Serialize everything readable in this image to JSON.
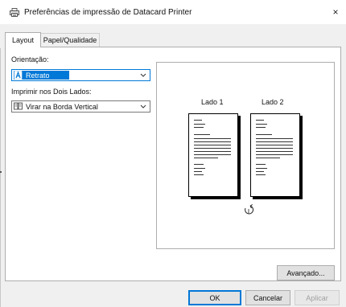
{
  "window": {
    "title": "Preferências de impressão de Datacard Printer",
    "close_label": "×"
  },
  "tabs": [
    {
      "label": "Layout",
      "active": true
    },
    {
      "label": "Papel/Qualidade",
      "active": false
    }
  ],
  "orientation": {
    "label": "Orientação:",
    "value": "Retrato"
  },
  "duplex": {
    "label": "Imprimir nos Dois Lados:",
    "value": "Virar na Borda Vertical"
  },
  "preview": {
    "side1_label": "Lado 1",
    "side2_label": "Lado 2"
  },
  "buttons": {
    "advanced": "Avançado...",
    "ok": "OK",
    "cancel": "Cancelar",
    "apply": "Aplicar"
  },
  "colors": {
    "accent": "#0078d7",
    "dialog_bg": "#f0f0f0",
    "panel_bg": "#ffffff"
  }
}
